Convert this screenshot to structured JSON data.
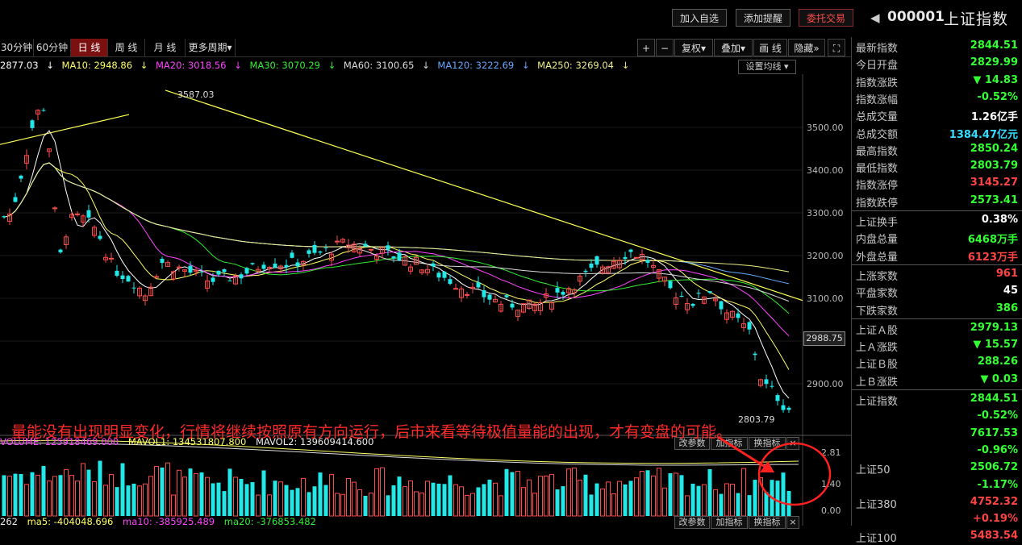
{
  "toolbar": {
    "add_watch": "加入自选",
    "add_alert": "添加提醒",
    "trade": "委托交易",
    "code": "000001",
    "name": "上证指数"
  },
  "periods": [
    "30分钟",
    "60分钟",
    "日 线",
    "周 线",
    "月 线",
    "更多周期"
  ],
  "active_period": "日 线",
  "tools": [
    "+",
    "−",
    "复权",
    "叠加",
    "画 线",
    "隐藏"
  ],
  "ma_legend": [
    {
      "label": "2877.03",
      "color": "#ffffff"
    },
    {
      "label": "MA10: 2948.86",
      "color": "#ffff66"
    },
    {
      "label": "MA20: 3018.56",
      "color": "#ff44ff"
    },
    {
      "label": "MA30: 3070.29",
      "color": "#33ee33"
    },
    {
      "label": "MA60: 3100.65",
      "color": "#dddddd"
    },
    {
      "label": "MA120: 3222.69",
      "color": "#66aaff"
    },
    {
      "label": "MA250: 3269.04",
      "color": "#eeee88"
    }
  ],
  "set_ma": "设置均线",
  "price_axis": {
    "ticks": [
      "3500.00",
      "3400.00",
      "3300.00",
      "3200.00",
      "3100.00",
      "2900.00"
    ],
    "current": "2988.75"
  },
  "annotations": {
    "high": "3587.03",
    "low": "2803.79",
    "comment": "量能没有出现明显变化，行情将继续按照原有方向运行，后市来看等待极值量能的出现，才有变盘的可能。"
  },
  "volume": {
    "label": "VOLUME: 125918469.000",
    "mavol1": "MAVOL1: 134531807.800",
    "mavol2": "MAVOL2: 139609414.600",
    "axis": [
      "2.81",
      "1.40",
      "0.00"
    ],
    "buttons": [
      "改参数",
      "加指标",
      "换指标",
      "×"
    ]
  },
  "lower": {
    "prefix": "262",
    "ma5": "ma5: -404048.696",
    "ma10": "ma10: -385925.489",
    "ma20": "ma20: -376853.482",
    "buttons": [
      "改参数",
      "加指标",
      "换指标",
      "×"
    ]
  },
  "quote": [
    {
      "label": "最新指数",
      "value": "2844.51",
      "color": "#33ff33"
    },
    {
      "label": "今日开盘",
      "value": "2829.99",
      "color": "#33ff33"
    },
    {
      "label": "指数涨跌",
      "value": "▼ 14.83",
      "color": "#33ff33"
    },
    {
      "label": "指数涨幅",
      "value": "-0.52%",
      "color": "#33ff33"
    },
    {
      "label": "总成交量",
      "value": "1.26亿手",
      "color": "#ffffff"
    },
    {
      "label": "总成交额",
      "value": "1384.47亿元",
      "color": "#33ddff"
    },
    {
      "label": "最高指数",
      "value": "2850.24",
      "color": "#33ff33"
    },
    {
      "label": "最低指数",
      "value": "2803.79",
      "color": "#33ff33"
    },
    {
      "label": "指数涨停",
      "value": "3145.27",
      "color": "#ff4444"
    },
    {
      "label": "指数跌停",
      "value": "2573.41",
      "color": "#33ff33"
    }
  ],
  "stats": [
    {
      "label": "上证换手",
      "value": "0.38%",
      "color": "#ffffff"
    },
    {
      "label": "内盘总量",
      "value": "6468万手",
      "color": "#33ff33"
    },
    {
      "label": "外盘总量",
      "value": "6123万手",
      "color": "#ff4444"
    }
  ],
  "breadth": [
    {
      "label": "上涨家数",
      "value": "961",
      "color": "#ff4444"
    },
    {
      "label": "平盘家数",
      "value": "45",
      "color": "#ffffff"
    },
    {
      "label": "下跌家数",
      "value": "386",
      "color": "#33ff33"
    }
  ],
  "shares": [
    {
      "label": "上证Ａ股",
      "value": "2979.13",
      "color": "#33ff33"
    },
    {
      "label": "上Ａ涨跌",
      "value": "▼ 15.57",
      "color": "#33ff33"
    },
    {
      "label": "上证Ｂ股",
      "value": "288.26",
      "color": "#33ff33"
    },
    {
      "label": "上Ｂ涨跌",
      "value": "▼ 0.03",
      "color": "#33ff33"
    }
  ],
  "indices": [
    {
      "label": "上证指数",
      "value": "2844.51",
      "color": "#33ff33"
    },
    {
      "label": "",
      "value": "-0.52%",
      "color": "#33ff33"
    },
    {
      "label": "",
      "value": "7617.53",
      "color": "#33ff33"
    },
    {
      "label": "",
      "value": "-0.96%",
      "color": "#33ff33"
    },
    {
      "label": "上证50",
      "value": "2506.72",
      "color": "#33ff33"
    },
    {
      "label": "",
      "value": "-1.17%",
      "color": "#33ff33"
    },
    {
      "label": "上证380",
      "value": "4752.32",
      "color": "#ff4444"
    },
    {
      "label": "",
      "value": "+0.19%",
      "color": "#ff4444"
    },
    {
      "label": "上证100",
      "value": "5483.54",
      "color": "#ff4444"
    }
  ]
}
